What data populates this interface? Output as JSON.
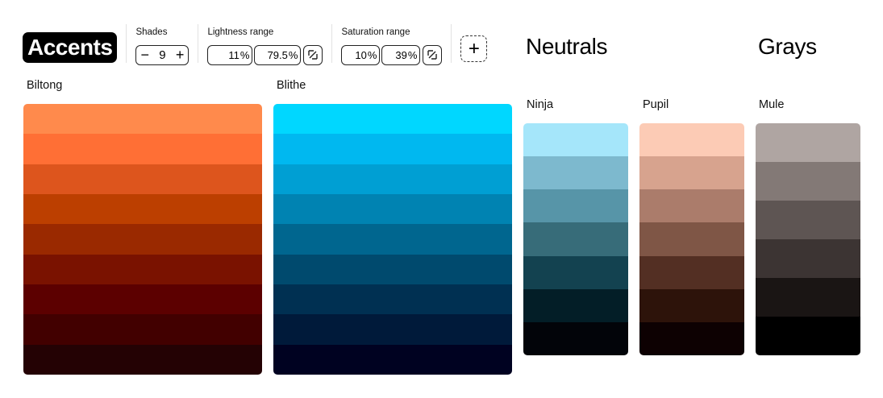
{
  "header": {
    "accents_title": "Accents",
    "neutrals_title": "Neutrals",
    "grays_title": "Grays"
  },
  "controls": {
    "shades_label": "Shades",
    "shades_value": "9",
    "minus_label": "−",
    "plus_label": "+",
    "lightness_label": "Lightness range",
    "lightness_min": "11",
    "lightness_max": "79.5",
    "saturation_label": "Saturation range",
    "saturation_min": "10",
    "saturation_max": "39",
    "percent_suffix": "%",
    "add_label": "+",
    "link_icon": "link-toggle-icon"
  },
  "palettes": {
    "biltong": {
      "name": "Biltong",
      "colors": [
        "#FF8A4C",
        "#FF6F35",
        "#DD551D",
        "#BC3F00",
        "#9A2900",
        "#7A1200",
        "#5C0000",
        "#420000",
        "#240204"
      ]
    },
    "blithe": {
      "name": "Blithe",
      "colors": [
        "#00D7FF",
        "#00B8F0",
        "#009FD3",
        "#0083B2",
        "#00668F",
        "#004A6E",
        "#003052",
        "#001A3A",
        "#000221"
      ]
    },
    "ninja": {
      "name": "Ninja",
      "colors": [
        "#A5E6FA",
        "#7DB9CE",
        "#5795A8",
        "#376C79",
        "#134250",
        "#031E27",
        "#020409"
      ]
    },
    "pupil": {
      "name": "Pupil",
      "colors": [
        "#FCCBB5",
        "#D7A38E",
        "#AB7C6B",
        "#7F5646",
        "#532F23",
        "#2D130A",
        "#0D0102"
      ]
    },
    "mule": {
      "name": "Mule",
      "colors": [
        "#AFA5A2",
        "#837976",
        "#5E5553",
        "#3C3433",
        "#1A1514",
        "#000000"
      ]
    }
  }
}
